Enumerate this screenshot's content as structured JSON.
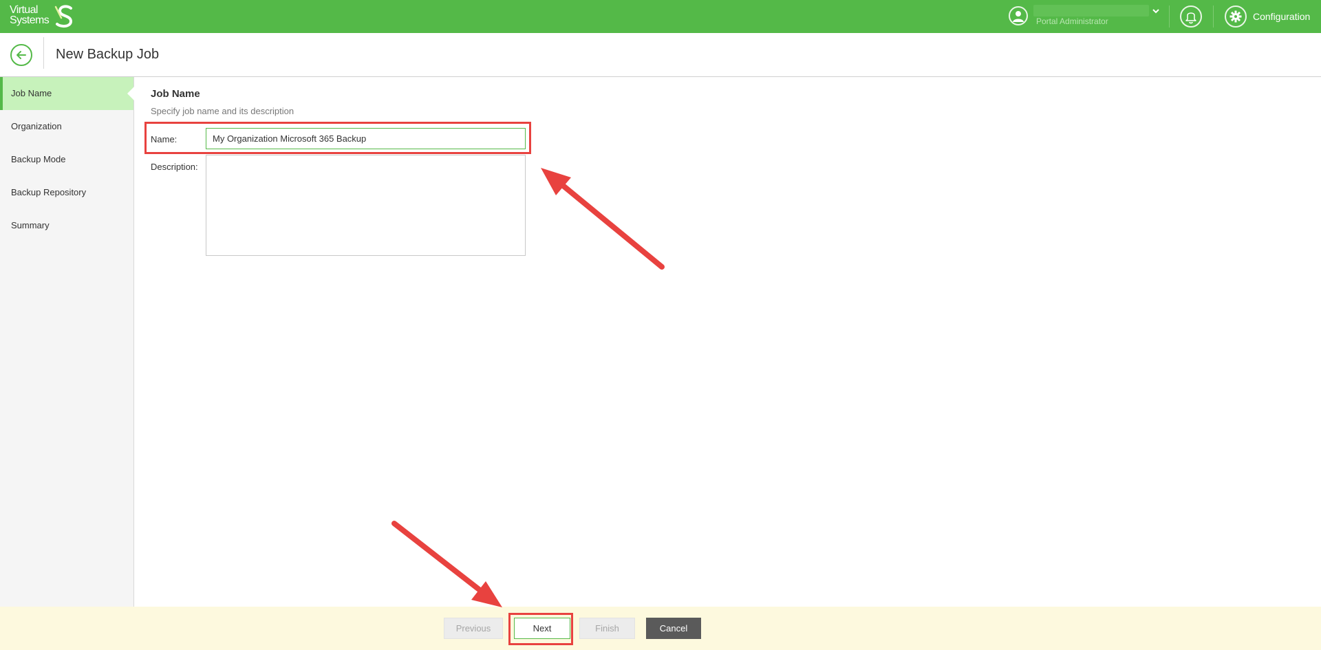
{
  "topbar": {
    "logo_line1": "Virtual",
    "logo_line2": "Systems",
    "user_role": "Portal Administrator",
    "config_label": "Configuration"
  },
  "header": {
    "title": "New Backup Job"
  },
  "sidebar": {
    "items": [
      {
        "label": "Job Name",
        "active": true
      },
      {
        "label": "Organization",
        "active": false
      },
      {
        "label": "Backup Mode",
        "active": false
      },
      {
        "label": "Backup Repository",
        "active": false
      },
      {
        "label": "Summary",
        "active": false
      }
    ]
  },
  "main": {
    "section_title": "Job Name",
    "section_subtitle": "Specify job name and its description",
    "name_label": "Name:",
    "name_value": "My Organization Microsoft 365 Backup",
    "description_label": "Description:",
    "description_value": ""
  },
  "footer": {
    "previous_label": "Previous",
    "next_label": "Next",
    "finish_label": "Finish",
    "cancel_label": "Cancel"
  },
  "colors": {
    "brand_green": "#54b948",
    "active_step_bg": "#c7f2bb",
    "footer_bg": "#fdf9de",
    "annotation_red": "#e8423f",
    "cancel_bg": "#5a5a5a"
  },
  "icons": [
    "logo-s-icon",
    "user-avatar-icon",
    "chevron-down-icon",
    "bell-icon",
    "gear-icon",
    "back-arrow-icon"
  ]
}
